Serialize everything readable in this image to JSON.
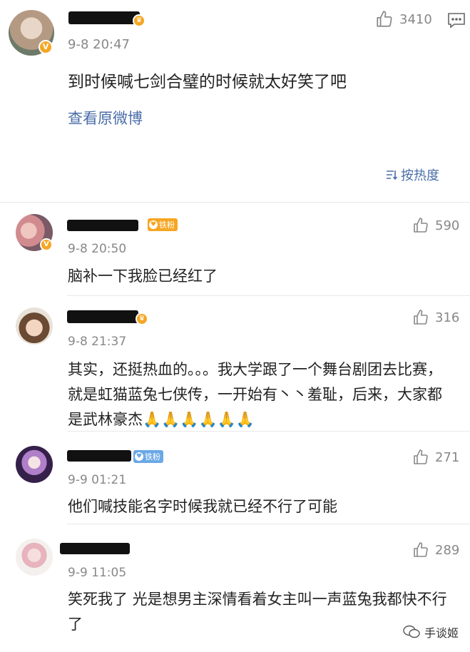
{
  "post": {
    "time": "9-8 20:47",
    "like_count": "3410",
    "text": "到时候喊七剑合璧的时候就太好笑了吧",
    "view_original": "查看原微博",
    "sort_label": "按热度"
  },
  "comments": [
    {
      "time": "9-8 20:50",
      "likes": "590",
      "text": "脑补一下我脸已经红了",
      "badge": "铁粉"
    },
    {
      "time": "9-8 21:37",
      "likes": "316",
      "text": "其实，还挺热血的。。。我大学跟了一个舞台剧团去比赛，就是虹猫蓝兔七侠传，一开始有丶丶羞耻，后来，大家都是武林豪杰🙏🙏🙏🙏🙏🙏"
    },
    {
      "time": "9-9 01:21",
      "likes": "271",
      "text": "他们喊技能名字时候我就已经不行了可能",
      "badge": "铁粉"
    },
    {
      "time": "9-9 11:05",
      "likes": "289",
      "text": "笑死我了 光是想男主深情看着女主叫一声蓝兔我都快不行了"
    }
  ],
  "watermark": "手谈姬",
  "colors": {
    "link": "#4a6ea9",
    "badge_orange": "#f5a623",
    "badge_blue": "#6aa8e6"
  }
}
